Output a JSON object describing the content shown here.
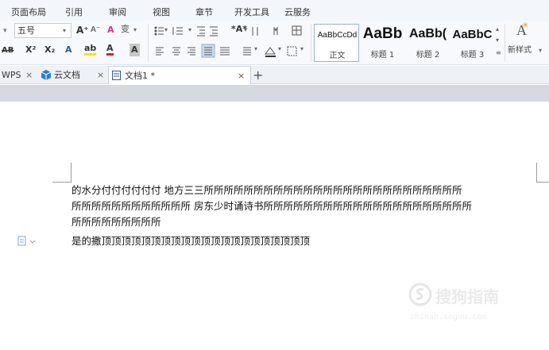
{
  "menu_tabs": [
    "页面布局",
    "引用",
    "审阅",
    "视图",
    "章节",
    "开发工具",
    "云服务"
  ],
  "ribbon": {
    "font_size": "五号",
    "grow_font": "A⁺",
    "shrink_font": "A⁻",
    "clear_format": "A",
    "phonetic": "变",
    "strike": "AB",
    "superscript": "X²",
    "subscript": "X₂",
    "text_effect": "A",
    "highlight": "ab",
    "font_color": "A",
    "char_shading": "A",
    "styles": [
      {
        "sample": "AaBbCcDd",
        "name": "正文"
      },
      {
        "sample": "AaBb",
        "name": "标题 1"
      },
      {
        "sample": "AaBb(",
        "name": "标题 2"
      },
      {
        "sample": "AaBbC",
        "name": "标题 3"
      }
    ],
    "new_style_label": "新样式",
    "new_style_icon_text": "A"
  },
  "doc_tabs": {
    "wps_label": "WPS",
    "cloud_label": "云文档",
    "active_label": "文档1 *",
    "add_label": "+"
  },
  "document": {
    "line1": "的水分付付付付付付    地方三三所所所所所所所所所所所所所所所所所所所所所所所所所所",
    "line2": "所所所所所所所所所所所所 房东少时诵诗书所所所所所所所所所所所所所所所所所所所所所",
    "line3": "所所所所所所所所所",
    "line4": "是的撒顶顶顶顶顶顶顶顶顶顶顶顶顶顶顶顶顶顶顶顶顶"
  },
  "watermark": {
    "text": "搜狗指南",
    "sub": "zhinan.sogou.com"
  },
  "colors": {
    "accent": "#2b579a",
    "cloud_blue": "#2a7fd4",
    "highlight_yellow": "#ffe100",
    "font_red": "#e02020"
  }
}
